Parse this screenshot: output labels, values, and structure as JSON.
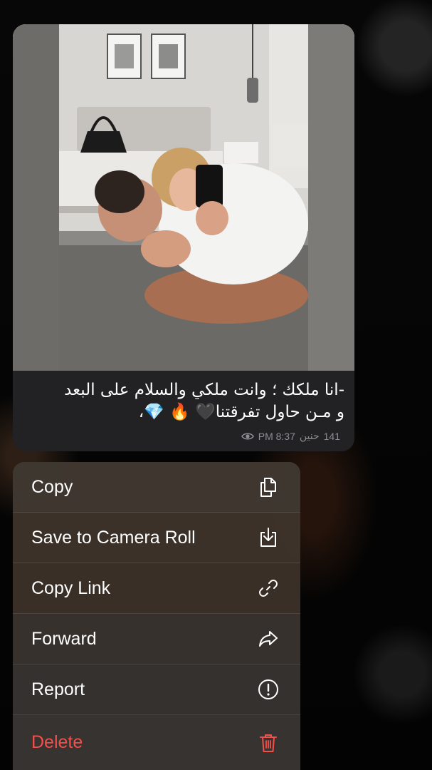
{
  "message": {
    "caption_line1": "-انا ملكك ؛ وانت ملكي والسلام على البعد",
    "caption_line2": "و مـن حاول تفرقتنا🖤 🔥 💎،",
    "views": "141",
    "author": "حنين",
    "time": "PM 8:37"
  },
  "menu": {
    "items": [
      {
        "label": "Copy",
        "icon": "copy-icon"
      },
      {
        "label": "Save to Camera Roll",
        "icon": "save-icon"
      },
      {
        "label": "Copy Link",
        "icon": "link-icon"
      },
      {
        "label": "Forward",
        "icon": "forward-icon"
      },
      {
        "label": "Report",
        "icon": "report-icon"
      },
      {
        "label": "Delete",
        "icon": "trash-icon"
      }
    ]
  },
  "colors": {
    "destructive": "#f2504a",
    "menu_text": "#ffffff",
    "meta_text": "#8e8e93"
  }
}
